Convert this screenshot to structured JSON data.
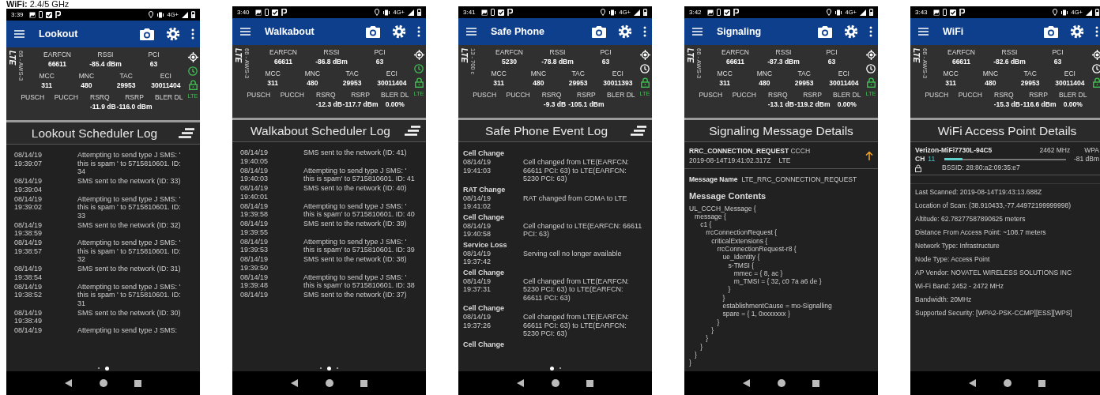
{
  "caption": "**WiFi:** 2.4/5 GHz",
  "screens": [
    {
      "time": "3:39",
      "network": "4G+",
      "title": "Lookout",
      "tech": "LTE",
      "band": "66 - AWS-3",
      "clock_active": true,
      "lock_label": "LTE",
      "stats": [
        [
          {
            "label": "EARFCN",
            "value": "66611"
          },
          {
            "label": "RSSI",
            "value": "-85.4 dBm"
          },
          {
            "label": "PCI",
            "value": "63"
          }
        ],
        [
          {
            "label": "MCC",
            "value": "311"
          },
          {
            "label": "MNC",
            "value": "480"
          },
          {
            "label": "TAC",
            "value": "29953"
          },
          {
            "label": "ECI",
            "value": "30011404"
          }
        ],
        [
          {
            "label": "PUSCH"
          },
          {
            "label": "PUCCH"
          },
          {
            "label": "RSRQ",
            "value": "-11.9 dB"
          },
          {
            "label": "RSRP",
            "value": "-116.0 dBm"
          },
          {
            "label": "BLER DL"
          }
        ]
      ],
      "panel": {
        "kind": "log",
        "title": "Lookout Scheduler Log",
        "entries": [
          {
            "timestamp": "08/14/19 19:39:07",
            "text": "Attempting to send type J SMS: ' this is spam ' to 5715810601. ID: 34"
          },
          {
            "timestamp": "08/14/19 19:39:04",
            "text": "SMS sent to the network (ID: 33)"
          },
          {
            "timestamp": "08/14/19 19:39:02",
            "text": "Attempting to send type J SMS: ' this is spam ' to 5715810601. ID: 33"
          },
          {
            "timestamp": "08/14/19 19:38:59",
            "text": "SMS sent to the network (ID: 32)"
          },
          {
            "timestamp": "08/14/19 19:38:57",
            "text": "Attempting to send type J SMS: ' this is spam ' to 5715810601. ID: 32"
          },
          {
            "timestamp": "08/14/19 19:38:54",
            "text": "SMS sent to the network (ID: 31)"
          },
          {
            "timestamp": "08/14/19 19:38:52",
            "text": "Attempting to send type J SMS: ' this is spam ' to 5715810601. ID: 31"
          },
          {
            "timestamp": "08/14/19 19:38:49",
            "text": "SMS sent to the network (ID: 30)"
          },
          {
            "timestamp": "08/14/19",
            "text": "Attempting to send type J SMS:"
          }
        ]
      },
      "page_dots": [
        {
          "selected": false
        },
        {
          "selected": true
        }
      ]
    },
    {
      "time": "3:40",
      "network": "4G+",
      "title": "Walkabout",
      "tech": "LTE",
      "band": "66 - AWS-3",
      "clock_active": true,
      "lock_label": "LTE",
      "stats": [
        [
          {
            "label": "EARFCN",
            "value": "66611"
          },
          {
            "label": "RSSI",
            "value": "-86.8 dBm"
          },
          {
            "label": "PCI",
            "value": "63"
          }
        ],
        [
          {
            "label": "MCC",
            "value": "311"
          },
          {
            "label": "MNC",
            "value": "480"
          },
          {
            "label": "TAC",
            "value": "29953"
          },
          {
            "label": "ECI",
            "value": "30011404"
          }
        ],
        [
          {
            "label": "PUSCH"
          },
          {
            "label": "PUCCH"
          },
          {
            "label": "RSRQ",
            "value": "-12.3 dB"
          },
          {
            "label": "RSRP",
            "value": "-117.7 dBm"
          },
          {
            "label": "BLER DL",
            "value": "0.00%"
          }
        ]
      ],
      "panel": {
        "kind": "log",
        "title": "Walkabout Scheduler Log",
        "entries": [
          {
            "timestamp": "08/14/19 19:40:05",
            "text": "SMS sent to the network (ID: 41)"
          },
          {
            "timestamp": "08/14/19 19:40:03",
            "text": "Attempting to send type J SMS: ' this is spam' to 5715810601. ID: 41"
          },
          {
            "timestamp": "08/14/19 19:40:01",
            "text": "SMS sent to the network (ID: 40)"
          },
          {
            "timestamp": "08/14/19 19:39:58",
            "text": "Attempting to send type J SMS: ' this is spam' to 5715810601. ID: 40"
          },
          {
            "timestamp": "08/14/19 19:39:55",
            "text": "SMS sent to the network (ID: 39)"
          },
          {
            "timestamp": "08/14/19 19:39:53",
            "text": "Attempting to send type J SMS: ' this is spam' to 5715810601. ID: 39"
          },
          {
            "timestamp": "08/14/19 19:39:50",
            "text": "SMS sent to the network (ID: 38)"
          },
          {
            "timestamp": "08/14/19 19:39:48",
            "text": "Attempting to send type J SMS: ' this is spam' to 5715810601. ID: 38"
          },
          {
            "timestamp": "08/14/19",
            "text": "SMS sent to the network (ID: 37)"
          }
        ]
      },
      "page_dots": [
        {
          "selected": false
        },
        {
          "selected": true
        },
        {
          "selected": false
        }
      ]
    },
    {
      "time": "3:41",
      "network": "4G+",
      "title": "Safe Phone",
      "tech": "LTE",
      "band": "13 - 700 c",
      "clock_active": false,
      "lock_label": "LTE",
      "stats": [
        [
          {
            "label": "EARFCN",
            "value": "5230"
          },
          {
            "label": "RSSI",
            "value": "-78.8 dBm"
          },
          {
            "label": "PCI",
            "value": "63"
          }
        ],
        [
          {
            "label": "MCC",
            "value": "311"
          },
          {
            "label": "MNC",
            "value": "480"
          },
          {
            "label": "TAC",
            "value": "29953"
          },
          {
            "label": "ECI",
            "value": "30011393"
          }
        ],
        [
          {
            "label": "PUSCH"
          },
          {
            "label": "PUCCH"
          },
          {
            "label": "RSRQ",
            "value": "-9.3 dB"
          },
          {
            "label": "RSRP",
            "value": "-105.1 dBm"
          },
          {
            "label": "BLER DL"
          }
        ]
      ],
      "panel": {
        "kind": "event_log",
        "title": "Safe Phone Event Log",
        "groups": [
          {
            "heading": "Cell Change",
            "timestamp": "08/14/19 19:41:03",
            "text": "Cell changed from LTE(EARFCN: 66611 PCI: 63) to LTE(EARFCN: 5230 PCI: 63)"
          },
          {
            "heading": "RAT Change",
            "timestamp": "08/14/19 19:41:02",
            "text": "RAT changed from CDMA to LTE"
          },
          {
            "heading": "Cell Change",
            "timestamp": "08/14/19 19:40:58",
            "text": "Cell changed to LTE(EARFCN: 66611 PCI: 63)"
          },
          {
            "heading": "Service Loss",
            "timestamp": "08/14/19 19:37:42",
            "text": "Serving cell no longer available"
          },
          {
            "heading": "Cell Change",
            "timestamp": "08/14/19 19:37:31",
            "text": "Cell changed from LTE(EARFCN: 5230 PCI: 63) to LTE(EARFCN: 66611 PCI: 63)"
          },
          {
            "heading": "Cell Change",
            "timestamp": "08/14/19 19:37:26",
            "text": "Cell changed from LTE(EARFCN: 66611 PCI: 63) to LTE(EARFCN: 5230 PCI: 63)"
          },
          {
            "heading": "Cell Change"
          }
        ]
      },
      "page_dots": [
        {
          "selected": true
        },
        {
          "selected": false
        }
      ]
    },
    {
      "time": "3:42",
      "network": "4G+",
      "title": "Signaling",
      "tech": "LTE",
      "band": "66 - AWS-3",
      "clock_active": false,
      "lock_label": "LTE",
      "stats": [
        [
          {
            "label": "EARFCN",
            "value": "66611"
          },
          {
            "label": "RSSI",
            "value": "-87.3 dBm"
          },
          {
            "label": "PCI",
            "value": "63"
          }
        ],
        [
          {
            "label": "MCC",
            "value": "311"
          },
          {
            "label": "MNC",
            "value": "480"
          },
          {
            "label": "TAC",
            "value": "29953"
          },
          {
            "label": "ECI",
            "value": "30011404"
          }
        ],
        [
          {
            "label": "PUSCH"
          },
          {
            "label": "PUCCH"
          },
          {
            "label": "RSRQ",
            "value": "-13.1 dB"
          },
          {
            "label": "RSRP",
            "value": "-119.2 dBm"
          },
          {
            "label": "BLER DL",
            "value": "0.00%"
          }
        ]
      ],
      "panel": {
        "kind": "message",
        "title": "Signaling Message Details",
        "message_type": "RRC_CONNECTION_REQUEST",
        "channel": "CCCH",
        "timestamp": "2019-08-14T19:41:02.317Z",
        "rat": "LTE",
        "name_label": "Message Name",
        "name": "LTE_RRC_CONNECTION_REQUEST",
        "contents_label": "Message Contents",
        "contents": "UL_CCCH_Message {\n   message {\n      c1 {\n         rrcConnectionRequest {\n            criticalExtensions {\n               rrcConnectionRequest-r8 {\n                  ue_Identity {\n                     s-TMSI {\n                        mmec = { 8, ac }\n                        m_TMSI = { 32, c0 7a a6 de }\n                     }\n                  }\n                  establishmentCause = mo-Signalling\n                  spare = { 1, 0xxxxxxx }\n               }\n            }\n         }\n      }\n   }\n}"
      }
    },
    {
      "time": "3:43",
      "network": "4G+",
      "title": "WiFi",
      "tech": "LTE",
      "band": "66 - AWS-3",
      "clock_active": false,
      "stats": [
        [
          {
            "label": "EARFCN",
            "value": "66611"
          },
          {
            "label": "RSSI",
            "value": "-82.6 dBm"
          },
          {
            "label": "PCI",
            "value": "63"
          }
        ],
        [
          {
            "label": "MCC",
            "value": "311"
          },
          {
            "label": "MNC",
            "value": "480"
          },
          {
            "label": "TAC",
            "value": "29953"
          },
          {
            "label": "ECI",
            "value": "30011404"
          }
        ],
        [
          {
            "label": "PUSCH"
          },
          {
            "label": "PUCCH"
          },
          {
            "label": "RSRQ",
            "value": "-15.3 dB"
          },
          {
            "label": "RSRP",
            "value": "-116.6 dBm"
          },
          {
            "label": "BLER DL",
            "value": "0.00%"
          }
        ]
      ],
      "panel": {
        "kind": "wifi",
        "title": "WiFi Access Point Details",
        "ap": {
          "ssid": "Verizon-MiFi7730L-94C5",
          "frequency": "2462 MHz",
          "security": "WPA",
          "channel_label": "CH",
          "channel": "11",
          "level": 0.15,
          "rssi": "-81 dBm",
          "bssid": "BSSID: 28:80:a2:09:35:e7"
        },
        "details": [
          "Last Scanned:  2019-08-14T19:43:13.688Z",
          "Location of Scan:  (38.910433,-77.44972199999998)",
          "Altitude:  62.78277587890625 meters",
          "Distance From Access Point:  ~108.7 meters",
          "Network Type:  Infrastructure",
          "Node Type:  Access Point",
          "AP Vendor:  NOVATEL WIRELESS SOLUTIONS INC",
          "Wi-Fi Band:  2452 - 2472 MHz",
          "Bandwidth:  20MHz",
          "Supported Security:  [WPA2-PSK-CCMP][ESS][WPS]"
        ]
      }
    }
  ]
}
